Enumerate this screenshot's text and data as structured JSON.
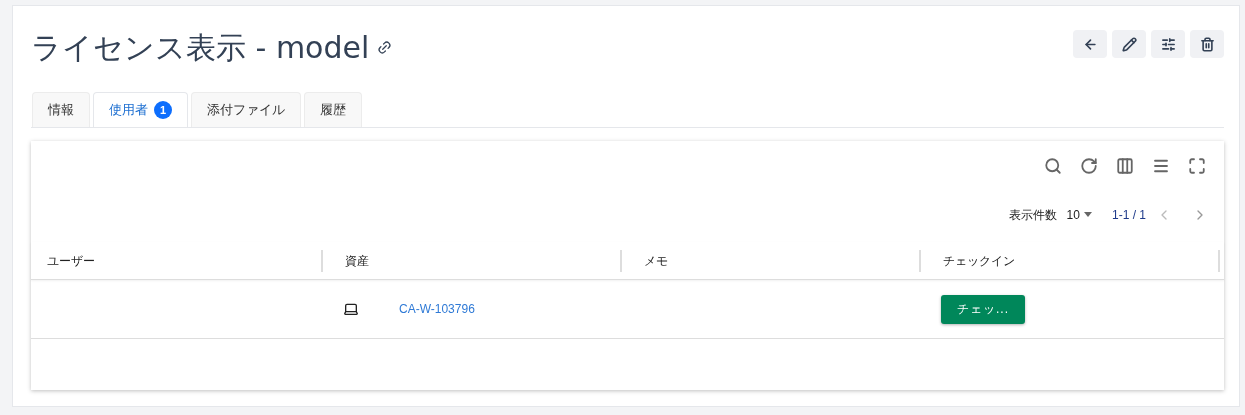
{
  "title": "ライセンス表示 - model",
  "tabs": [
    {
      "label": "情報",
      "selected": false
    },
    {
      "label": "使用者",
      "selected": true,
      "badge": "1"
    },
    {
      "label": "添付ファイル",
      "selected": false
    },
    {
      "label": "履歴",
      "selected": false
    }
  ],
  "pagination": {
    "page_size_label": "表示件数",
    "page_size": "10",
    "range": "1-1 / 1"
  },
  "table": {
    "columns": [
      "ユーザー",
      "資産",
      "メモ",
      "チェックイン"
    ],
    "rows": [
      {
        "user": "",
        "asset": "CA-W-103796",
        "memo": "",
        "checkin_button": "チェッ..."
      }
    ]
  }
}
